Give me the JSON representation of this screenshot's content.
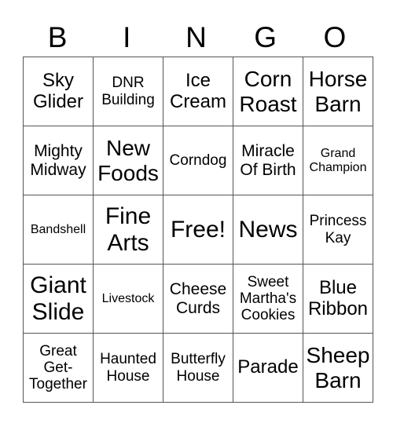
{
  "title_letters": [
    "B",
    "I",
    "N",
    "G",
    "O"
  ],
  "rows": [
    [
      "Sky Glider",
      "DNR Building",
      "Ice Cream",
      "Corn Roast",
      "Horse Barn"
    ],
    [
      "Mighty Midway",
      "New Foods",
      "Corndog",
      "Miracle Of Birth",
      "Grand Champion"
    ],
    [
      "Bandshell",
      "Fine Arts",
      "Free!",
      "News",
      "Princess Kay"
    ],
    [
      "Giant Slide",
      "Livestock",
      "Cheese Curds",
      "Sweet Martha's Cookies",
      "Blue Ribbon"
    ],
    [
      "Great Get-Together",
      "Haunted House",
      "Butterfly House",
      "Parade",
      "Sheep Barn"
    ]
  ],
  "free_space": "Free!"
}
